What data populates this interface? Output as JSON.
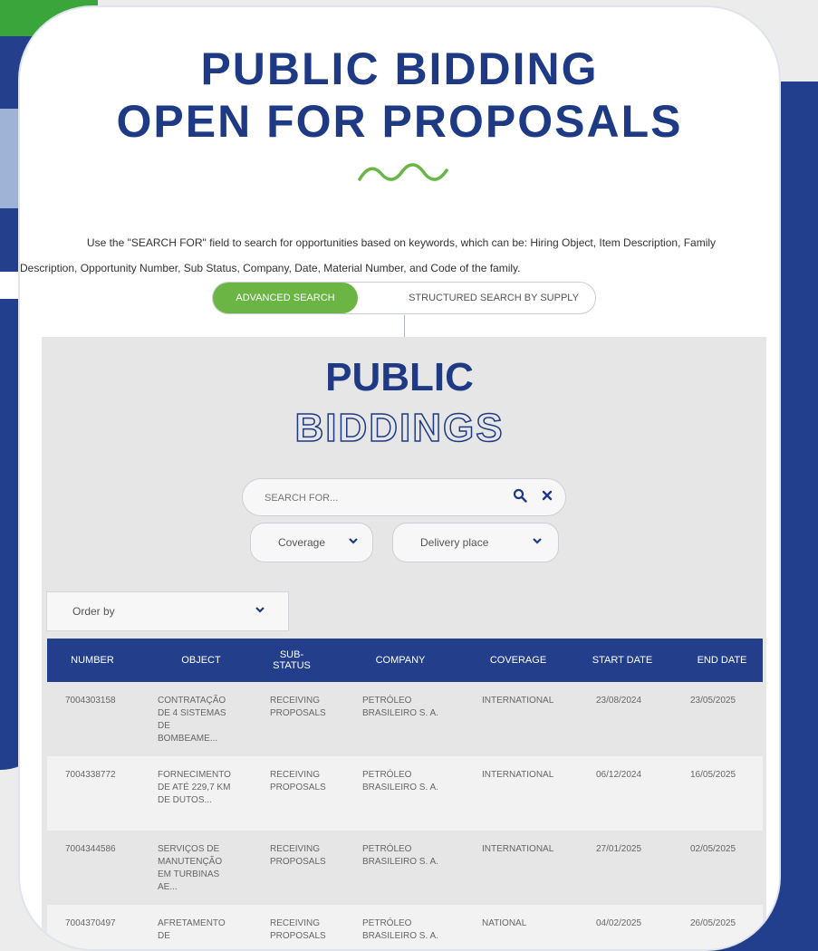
{
  "hero": {
    "title_line1": "PUBLIC BIDDING",
    "title_line2": "OPEN FOR PROPOSALS",
    "intro_line1": "Use the \"SEARCH FOR\" field to search for opportunities based on keywords, which can be: Hiring Object, Item Description, Family",
    "intro_line2": "Description, Opportunity Number, Sub Status, Company, Date, Material Number, and Code of the family."
  },
  "tabs": {
    "advanced": "ADVANCED SEARCH",
    "structured": "STRUCTURED SEARCH BY SUPPLY"
  },
  "panel": {
    "title_line1": "PUBLIC",
    "title_line2": "BIDDINGS"
  },
  "search": {
    "placeholder": "SEARCH FOR..."
  },
  "filters": {
    "coverage": "Coverage",
    "delivery": "Delivery place",
    "order_by": "Order by"
  },
  "table": {
    "headers": [
      "NUMBER",
      "OBJECT",
      "SUB-\nSTATUS",
      "COMPANY",
      "COVERAGE",
      "START DATE",
      "END DATE"
    ],
    "rows": [
      {
        "number": "7004303158",
        "object": "CONTRATAÇÃO\nDE 4 SISTEMAS\nDE\nBOMBEAME...",
        "status": "RECEIVING\nPROPOSALS",
        "company": "PETRÓLEO\nBRASILEIRO S. A.",
        "coverage": "INTERNATIONAL",
        "start": "23/08/2024",
        "end": "23/05/2025"
      },
      {
        "number": "7004338772",
        "object": "FORNECIMENTO\nDE ATÉ 229,7 KM\nDE DUTOS...",
        "status": "RECEIVING\nPROPOSALS",
        "company": "PETRÓLEO\nBRASILEIRO S. A.",
        "coverage": "INTERNATIONAL",
        "start": "06/12/2024",
        "end": "16/05/2025"
      },
      {
        "number": "7004344586",
        "object": "SERVIÇOS DE\nMANUTENÇÃO\nEM TURBINAS\nAE...",
        "status": "RECEIVING\nPROPOSALS",
        "company": "PETRÓLEO\nBRASILEIRO S. A.",
        "coverage": "INTERNATIONAL",
        "start": "27/01/2025",
        "end": "02/05/2025"
      },
      {
        "number": "7004370497",
        "object": "AFRETAMENTO\nDE",
        "status": "RECEIVING\nPROPOSALS",
        "company": "PETRÓLEO\nBRASILEIRO S. A.",
        "coverage": "NATIONAL",
        "start": "04/02/2025",
        "end": "26/05/2025"
      }
    ]
  },
  "colors": {
    "navy": "#223f8d",
    "green": "#6ab544",
    "title_navy": "#1f3a84"
  }
}
